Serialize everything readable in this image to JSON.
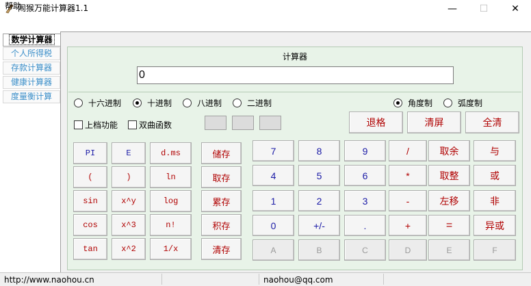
{
  "window": {
    "title": "闹猴万能计算器1.1",
    "minimize": "—",
    "maximize": "☐",
    "close": "✕"
  },
  "menu": {
    "help": "帮助"
  },
  "nav": {
    "tabs": [
      {
        "label": "数学计算器"
      },
      {
        "label": "个人所得税"
      },
      {
        "label": "存款计算器"
      },
      {
        "label": "健康计算器"
      },
      {
        "label": "度量衡计算"
      }
    ]
  },
  "calc": {
    "title": "计算器",
    "display": "0",
    "radix": {
      "hex": "十六进制",
      "dec": "十进制",
      "oct": "八进制",
      "bin": "二进制"
    },
    "angle": {
      "deg": "角度制",
      "rad": "弧度制"
    },
    "checks": {
      "shift": "上档功能",
      "hyper": "双曲函数"
    },
    "buttons": {
      "backspace": "退格",
      "clear": "清屏",
      "clear_all": "全清",
      "pi": "PI",
      "e": "E",
      "dms": "d.ms",
      "lparen": "(",
      "rparen": ")",
      "ln": "ln",
      "sin": "sin",
      "xy": "x^y",
      "log": "log",
      "cos": "cos",
      "x3": "x^3",
      "fact": "n!",
      "tan": "tan",
      "x2": "x^2",
      "inv": "1/x",
      "mem_store": "储存",
      "mem_recall": "取存",
      "mem_add": "累存",
      "mem_mul": "积存",
      "mem_clear": "清存",
      "d7": "7",
      "d8": "8",
      "d9": "9",
      "div": "/",
      "mod": "取余",
      "and": "与",
      "d4": "4",
      "d5": "5",
      "d6": "6",
      "mul": "*",
      "int": "取整",
      "or": "或",
      "d1": "1",
      "d2": "2",
      "d3": "3",
      "sub": "-",
      "lsh": "左移",
      "not": "非",
      "d0": "0",
      "neg": "+/-",
      "dot": ".",
      "add": "+",
      "eq": "=",
      "xor": "异或",
      "hA": "A",
      "hB": "B",
      "hC": "C",
      "hD": "D",
      "hE": "E",
      "hF": "F"
    }
  },
  "status": {
    "url": "http://www.naohou.cn",
    "email": "naohou@qq.com"
  }
}
